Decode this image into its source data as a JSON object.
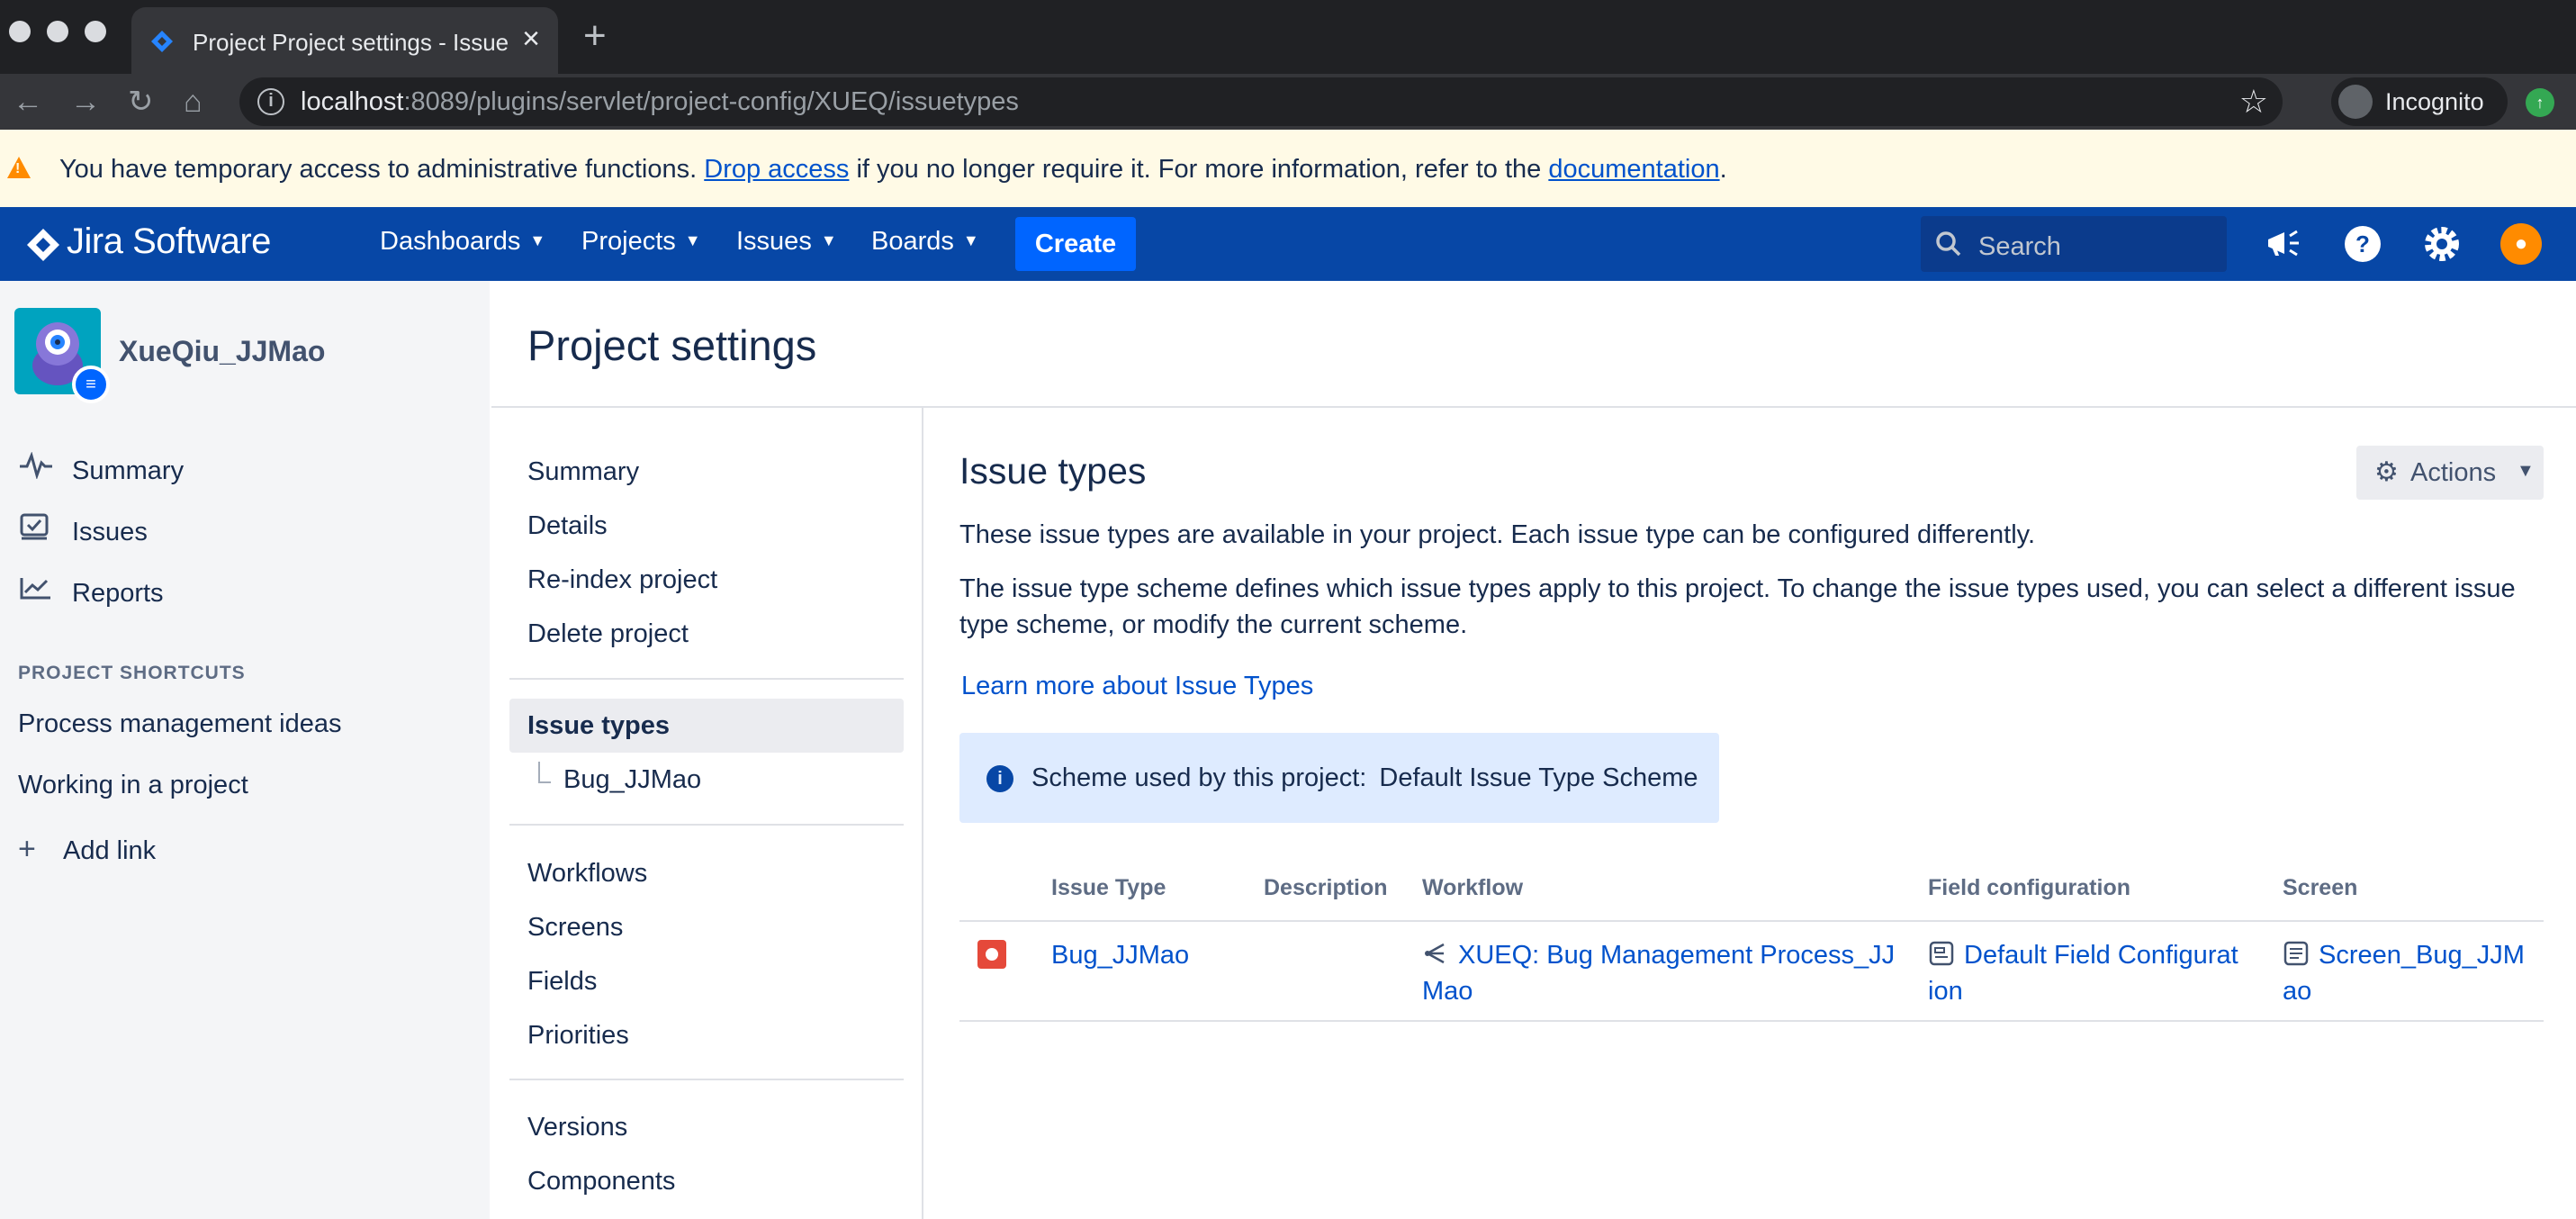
{
  "browser": {
    "tab_title": "Project Project settings - Issue",
    "url_host": "localhost",
    "url_rest": ":8089/plugins/servlet/project-config/XUEQ/issuetypes",
    "incognito_label": "Incognito"
  },
  "banner": {
    "text_before": "You have temporary access to administrative functions. ",
    "drop_access": "Drop access",
    "text_middle": " if you no longer require it. For more information, refer to the ",
    "documentation": "documentation",
    "text_end": "."
  },
  "header": {
    "brand": "Jira Software",
    "nav": [
      "Dashboards",
      "Projects",
      "Issues",
      "Boards"
    ],
    "create": "Create",
    "search_placeholder": "Search",
    "colors": {
      "bar": "#0747a6",
      "create": "#0065ff"
    }
  },
  "sidebar": {
    "project_name": "XueQiu_JJMao",
    "items": [
      "Summary",
      "Issues",
      "Reports"
    ],
    "shortcuts_heading": "PROJECT SHORTCUTS",
    "shortcuts": [
      "Process management ideas",
      "Working in a project"
    ],
    "add_link": "Add link"
  },
  "settings": {
    "page_title": "Project settings",
    "nav_group1": [
      "Summary",
      "Details",
      "Re-index project",
      "Delete project"
    ],
    "active_item": "Issue types",
    "sub_item": "Bug_JJMao",
    "nav_group2": [
      "Workflows",
      "Screens",
      "Fields",
      "Priorities"
    ],
    "nav_group3": [
      "Versions",
      "Components"
    ]
  },
  "content": {
    "title": "Issue types",
    "actions": "Actions",
    "para1": "These issue types are available in your project. Each issue type can be configured differently.",
    "para2": "The issue type scheme defines which issue types apply to this project. To change the issue types used, you can select a different issue type scheme, or modify the current scheme.",
    "learn_more": "Learn more about Issue Types",
    "scheme_label": "Scheme used by this project:",
    "scheme_name": "Default Issue Type Scheme",
    "columns": [
      "Issue Type",
      "Description",
      "Workflow",
      "Field configuration",
      "Screen"
    ],
    "rows": [
      {
        "issue_type": "Bug_JJMao",
        "description": "",
        "workflow_line1": "XUEQ: Bug Management Process_JJ",
        "workflow_line2": "Mao",
        "field_config_line1": "Default Field Configurat",
        "field_config_line2": "ion",
        "screen_line1": "Screen_Bug_JJM",
        "screen_line2": "ao"
      }
    ]
  }
}
